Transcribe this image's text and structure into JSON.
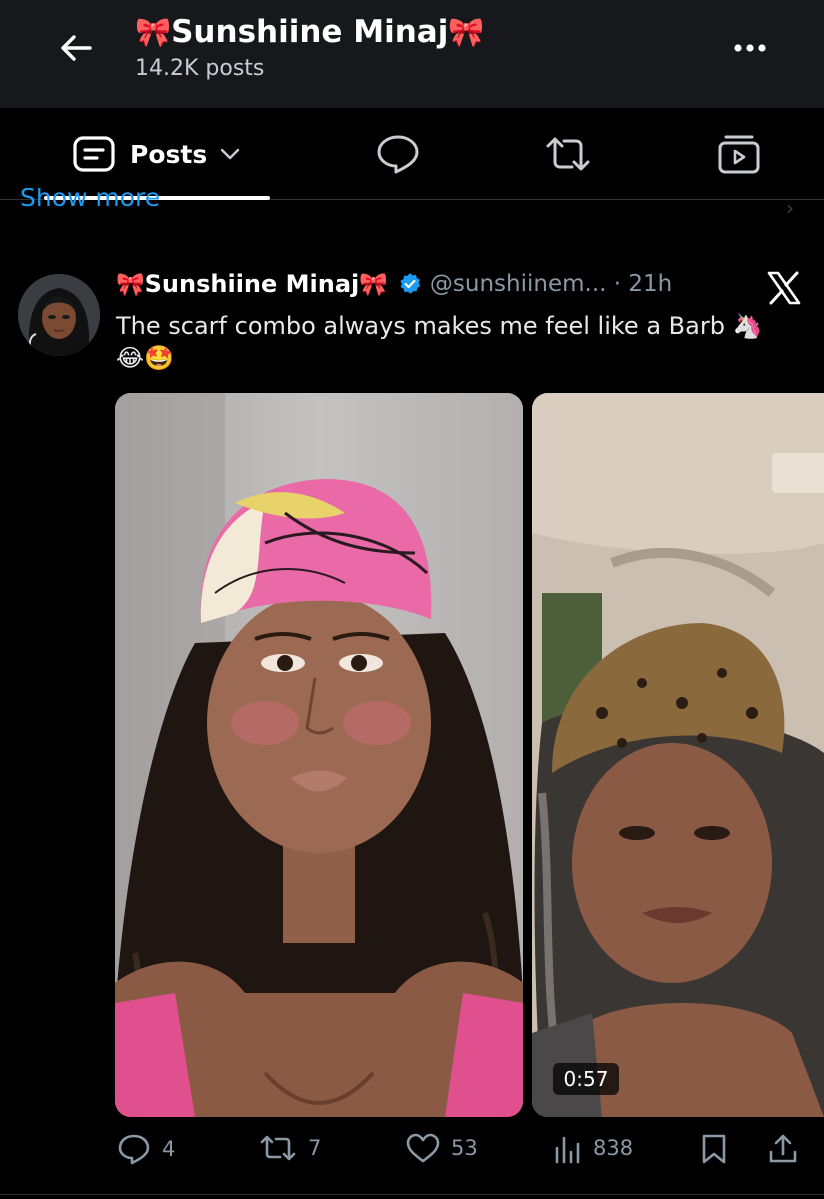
{
  "header": {
    "bow": "🎀",
    "name": "Sunshiine Minaj",
    "posts_count": "14.2K posts"
  },
  "tabs": {
    "posts_label": "Posts",
    "icons": [
      "posts-icon",
      "replies-icon",
      "reposts-icon",
      "media-icon"
    ]
  },
  "show_more": "Show more",
  "post": {
    "author_name": "Sunshiine Minaj",
    "bow": "🎀",
    "handle": "@sunshiinem...",
    "separator": "·",
    "time": "21h",
    "text": "The scarf combo always makes me feel like a Barb 🦄 😂🤩",
    "video_duration": "0:57",
    "stats": {
      "replies": "4",
      "reposts": "7",
      "likes": "53",
      "views": "838"
    }
  },
  "colors": {
    "header_bg": "#16181c",
    "accent_link": "#1d9bf0",
    "verified": "#1d9bf0",
    "muted": "#8b98a5",
    "bow": "#f7a8c8"
  }
}
